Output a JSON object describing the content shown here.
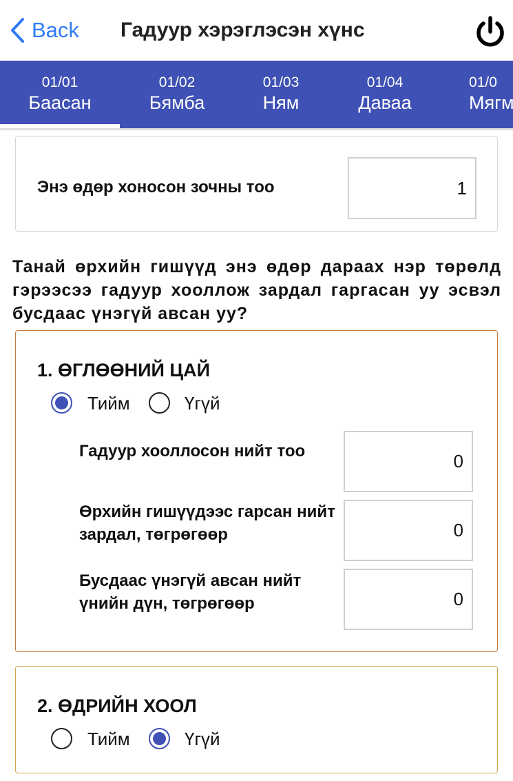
{
  "nav": {
    "back_label": "Back",
    "title": "Гадуур хэрэглэсэн хүнс",
    "accent": "#2f7cf6"
  },
  "tabs": [
    {
      "date": "01/01",
      "day": "Баасан"
    },
    {
      "date": "01/02",
      "day": "Бямба"
    },
    {
      "date": "01/03",
      "day": "Ням"
    },
    {
      "date": "01/04",
      "day": "Даваа"
    },
    {
      "date": "01/0",
      "day": "Мягм"
    }
  ],
  "tab_bar_color": "#3f51b5",
  "guests": {
    "label": "Энэ өдөр хоносон зочны тоо",
    "value": "1"
  },
  "question": "Танай өрхийн гишүүд энэ өдөр дараах нэр төрөлд гэрээсээ гадуур хооллож зардал гаргасан уу эсвэл бусдаас үнэгүй авсан уу?",
  "sections": [
    {
      "title": "1. ӨГЛӨӨНИЙ ЦАЙ",
      "yes_label": "Тийм",
      "no_label": "Үгүй",
      "selected": "yes",
      "fields": [
        {
          "label": "Гадуур хооллосон нийт тоо",
          "value": "0"
        },
        {
          "label": "Өрхийн гишүүдээс гарсан нийт зардал, төгрөгөөр",
          "value": "0"
        },
        {
          "label": "Бусдаас үнэгүй авсан нийт үнийн дүн, төгрөгөөр",
          "value": "0"
        }
      ]
    },
    {
      "title": "2. ӨДРИЙН ХООЛ",
      "yes_label": "Тийм",
      "no_label": "Үгүй",
      "selected": "no"
    }
  ]
}
